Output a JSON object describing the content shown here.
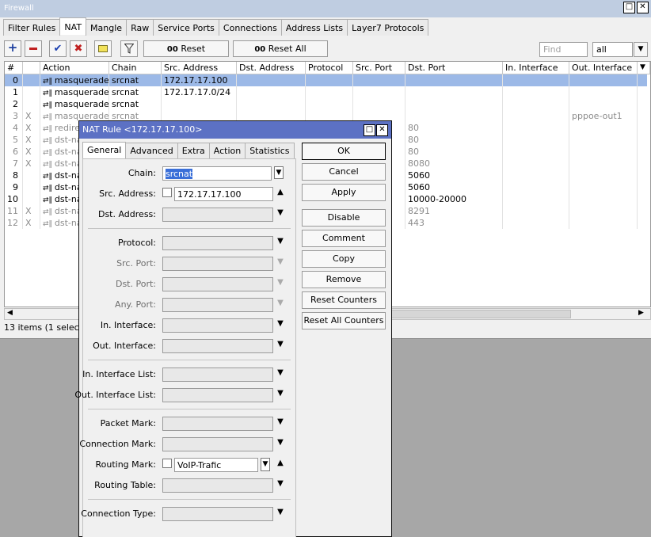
{
  "window": {
    "title": "Firewall",
    "restore_icon": "□",
    "close_icon": "✕"
  },
  "tabs": [
    "Filter Rules",
    "NAT",
    "Mangle",
    "Raw",
    "Service Ports",
    "Connections",
    "Address Lists",
    "Layer7 Protocols"
  ],
  "toolbar": {
    "reset_counters": "Reset Counters",
    "reset_all_counters": "Reset All Counters",
    "counter_icon": "00",
    "find_placeholder": "Find",
    "filter_select": "all"
  },
  "table": {
    "headers": [
      "#",
      "Action",
      "Chain",
      "Src. Address",
      "Dst. Address",
      "Protocol",
      "Src. Port",
      "Dst. Port",
      "In. Interface",
      "Out. Interface"
    ],
    "rows": [
      {
        "num": "0",
        "flag": "",
        "action": "masquerade",
        "chain": "srcnat",
        "src": "172.17.17.100",
        "dst_port": "",
        "out_if": ""
      },
      {
        "num": "1",
        "flag": "",
        "action": "masquerade",
        "chain": "srcnat",
        "src": "172.17.17.0/24",
        "dst_port": "",
        "out_if": ""
      },
      {
        "num": "2",
        "flag": "",
        "action": "masquerade",
        "chain": "srcnat",
        "src": "",
        "dst_port": "",
        "out_if": ""
      },
      {
        "num": "3",
        "flag": "X",
        "action": "masquerade",
        "chain": "srcnat",
        "src": "",
        "dst_port": "",
        "out_if": "pppoe-out1"
      },
      {
        "num": "4",
        "flag": "X",
        "action": "redirect",
        "chain": "",
        "src": "",
        "dst_port": "80",
        "out_if": ""
      },
      {
        "num": "5",
        "flag": "X",
        "action": "dst-nat",
        "chain": "",
        "src": "",
        "dst_port": "80",
        "out_if": ""
      },
      {
        "num": "6",
        "flag": "X",
        "action": "dst-nat",
        "chain": "",
        "src": "",
        "dst_port": "80",
        "out_if": ""
      },
      {
        "num": "7",
        "flag": "X",
        "action": "dst-nat",
        "chain": "",
        "src": "",
        "dst_port": "8080",
        "out_if": ""
      },
      {
        "num": "8",
        "flag": "",
        "action": "dst-nat",
        "chain": "",
        "src": "",
        "dst_port": "5060",
        "out_if": ""
      },
      {
        "num": "9",
        "flag": "",
        "action": "dst-nat",
        "chain": "",
        "src": "",
        "dst_port": "5060",
        "out_if": ""
      },
      {
        "num": "10",
        "flag": "",
        "action": "dst-nat",
        "chain": "",
        "src": "",
        "dst_port": "10000-20000",
        "out_if": ""
      },
      {
        "num": "11",
        "flag": "X",
        "action": "dst-nat",
        "chain": "",
        "src": "",
        "dst_port": "8291",
        "out_if": ""
      },
      {
        "num": "12",
        "flag": "X",
        "action": "dst-nat",
        "chain": "",
        "src": "",
        "dst_port": "443",
        "out_if": ""
      }
    ]
  },
  "status": "13 items (1 selected)",
  "dialog": {
    "title": "NAT Rule <172.17.17.100>",
    "tabs": [
      "General",
      "Advanced",
      "Extra",
      "Action",
      "Statistics"
    ],
    "fields": {
      "chain": {
        "label": "Chain:",
        "value": "srcnat"
      },
      "src_address": {
        "label": "Src. Address:",
        "value": "172.17.17.100"
      },
      "dst_address": {
        "label": "Dst. Address:"
      },
      "protocol": {
        "label": "Protocol:"
      },
      "src_port": {
        "label": "Src. Port:"
      },
      "dst_port": {
        "label": "Dst. Port:"
      },
      "any_port": {
        "label": "Any. Port:"
      },
      "in_interface": {
        "label": "In. Interface:"
      },
      "out_interface": {
        "label": "Out. Interface:"
      },
      "in_interface_list": {
        "label": "In. Interface List:"
      },
      "out_interface_list": {
        "label": "Out. Interface List:"
      },
      "packet_mark": {
        "label": "Packet Mark:"
      },
      "connection_mark": {
        "label": "Connection Mark:"
      },
      "routing_mark": {
        "label": "Routing Mark:",
        "value": "VoIP-Trafic"
      },
      "routing_table": {
        "label": "Routing Table:"
      },
      "connection_type": {
        "label": "Connection Type:"
      }
    },
    "buttons": {
      "ok": "OK",
      "cancel": "Cancel",
      "apply": "Apply",
      "disable": "Disable",
      "comment": "Comment",
      "copy": "Copy",
      "remove": "Remove",
      "reset_counters": "Reset Counters",
      "reset_all_counters": "Reset All Counters"
    }
  },
  "colors": {
    "selected_row": "#9cb9e7",
    "dialog_title": "#5c71c4",
    "window_title": "#bfcde1",
    "add": "#1c3f9f",
    "remove": "#c02020",
    "enable": "#1a3fb0"
  }
}
